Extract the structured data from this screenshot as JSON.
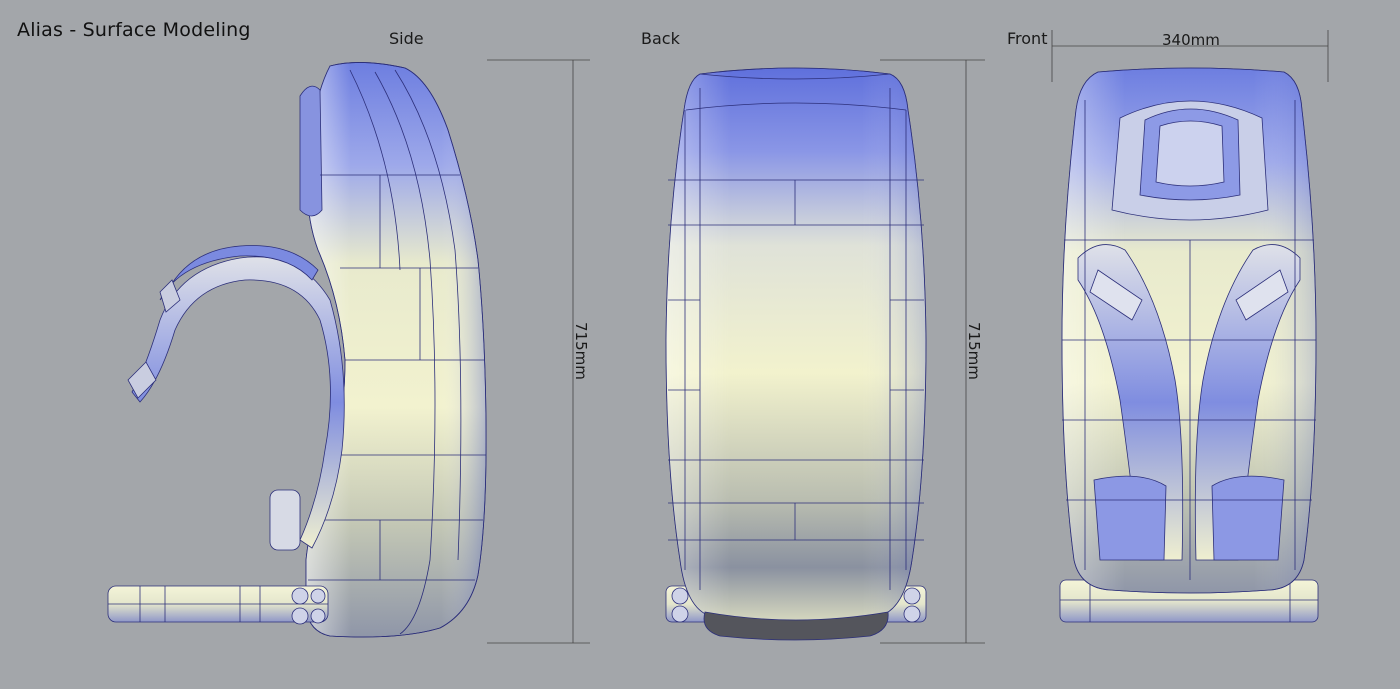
{
  "header": {
    "title": "Alias - Surface Modeling"
  },
  "views": {
    "side_label": "Side",
    "back_label": "Back",
    "front_label": "Front"
  },
  "dimensions": {
    "height_side": "715mm",
    "height_back": "715mm",
    "width_front": "340mm"
  },
  "colors": {
    "background": "#a3a6aa",
    "surface_light": "#f0f0cc",
    "surface_blue": "#6e7fe0",
    "wire": "#2c2f7a"
  }
}
